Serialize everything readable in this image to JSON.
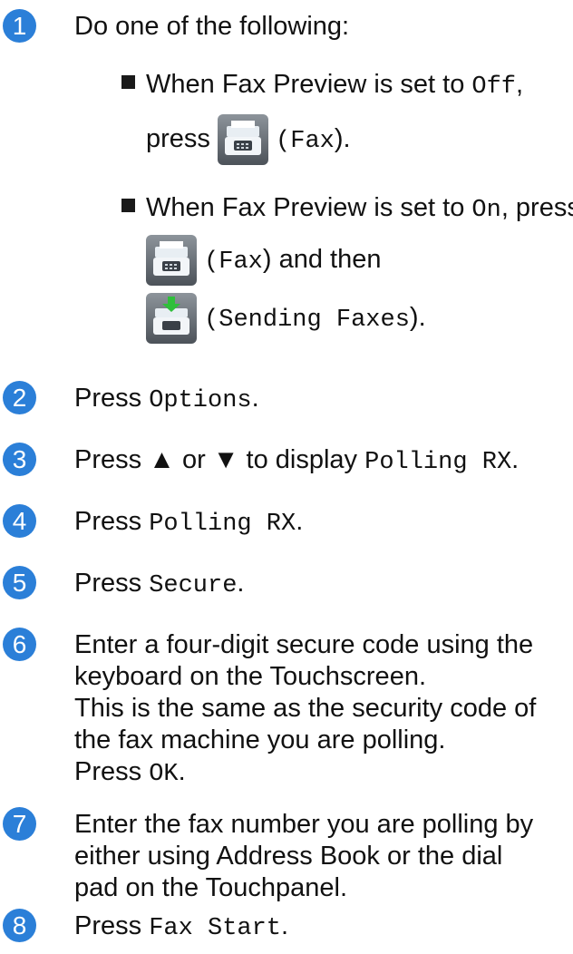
{
  "steps": [
    {
      "number": "1",
      "intro": "Do one of the following:",
      "bullets": [
        {
          "line1_prefix": "When Fax Preview is set to ",
          "line1_code": "Off",
          "line1_suffix": ",",
          "line2_prefix": "press",
          "icon": "fax-icon",
          "icon_label_code": "(Fax",
          "icon_label_suffix": ")."
        },
        {
          "line1_prefix": "When Fax Preview is set to ",
          "line1_code": "On",
          "line1_suffix": ", press",
          "icon": "fax-icon",
          "icon_label_code": "(Fax",
          "icon_label_suffix": ") and then",
          "icon2": "sending-faxes-icon",
          "icon2_label_code": "(Sending Faxes",
          "icon2_label_suffix": ")."
        }
      ]
    },
    {
      "number": "2",
      "prefix": "Press ",
      "code": "Options",
      "suffix": "."
    },
    {
      "number": "3",
      "prefix": "Press ▲ or ▼ to display ",
      "code": "Polling RX",
      "suffix": "."
    },
    {
      "number": "4",
      "prefix": "Press ",
      "code": "Polling RX",
      "suffix": "."
    },
    {
      "number": "5",
      "prefix": "Press ",
      "code": "Secure",
      "suffix": "."
    },
    {
      "number": "6",
      "lines": [
        "Enter a four-digit secure code using the",
        "keyboard on the Touchscreen.",
        "This is the same as the security code of",
        "the fax machine you are polling."
      ],
      "last_prefix": "Press ",
      "last_code": "OK",
      "last_suffix": "."
    },
    {
      "number": "7",
      "lines": [
        "Enter the fax number you are polling by",
        "either using Address Book or the dial",
        "pad on the Touchpanel."
      ]
    },
    {
      "number": "8",
      "prefix": "Press ",
      "code": "Fax Start",
      "suffix": "."
    }
  ],
  "colors": {
    "badge": "#2b7fd8",
    "text": "#111111"
  }
}
